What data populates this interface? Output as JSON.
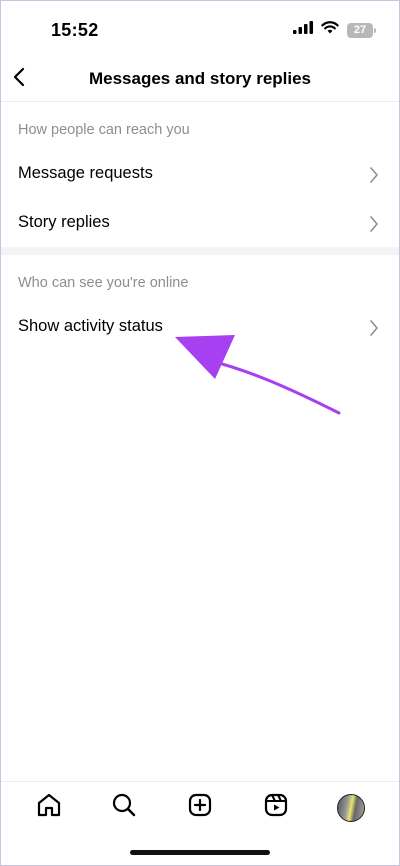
{
  "status_bar": {
    "time": "15:52",
    "battery": "27"
  },
  "header": {
    "title": "Messages and story replies"
  },
  "sections": [
    {
      "heading": "How people can reach you",
      "items": [
        {
          "label": "Message requests"
        },
        {
          "label": "Story replies"
        }
      ]
    },
    {
      "heading": "Who can see you're online",
      "items": [
        {
          "label": "Show activity status"
        }
      ]
    }
  ],
  "annotation": {
    "color": "#a640f0"
  },
  "tab_bar": {
    "items": [
      "home-icon",
      "search-icon",
      "create-icon",
      "reels-icon",
      "profile-avatar"
    ]
  }
}
